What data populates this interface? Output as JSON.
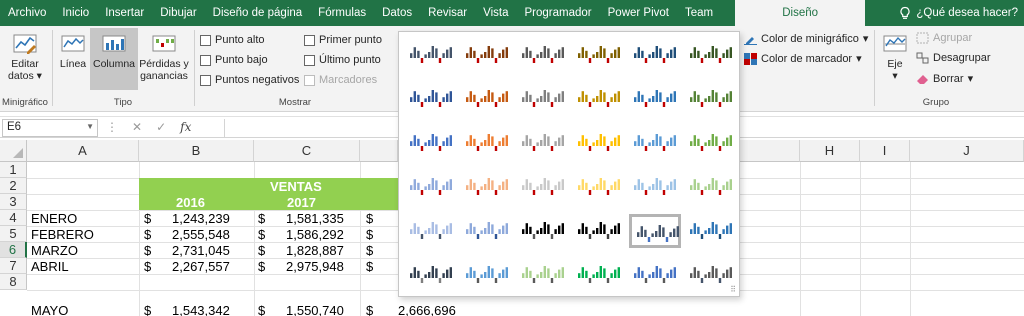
{
  "menu": {
    "tabs": [
      "Archivo",
      "Inicio",
      "Insertar",
      "Dibujar",
      "Diseño de página",
      "Fórmulas",
      "Datos",
      "Revisar",
      "Vista",
      "Programador",
      "Power Pivot",
      "Team"
    ],
    "active_tab": "Diseño",
    "help": "¿Qué desea hacer?"
  },
  "ribbon": {
    "sparkline_group": {
      "edit_line1": "Editar",
      "edit_line2": "datos",
      "label": "Minigráfico"
    },
    "type_group": {
      "line": "Línea",
      "column": "Columna",
      "winloss_line1": "Pérdidas y",
      "winloss_line2": "ganancias",
      "label": "Tipo"
    },
    "show_group": {
      "high_point": "Punto alto",
      "low_point": "Punto bajo",
      "negative_points": "Puntos negativos",
      "first_point": "Primer punto",
      "last_point": "Último punto",
      "markers": "Marcadores",
      "label": "Mostrar"
    },
    "style_group": {
      "sparkline_color": "Color de minigráfico",
      "marker_color": "Color de marcador"
    },
    "group_group": {
      "axis": "Eje",
      "group": "Agrupar",
      "ungroup": "Desagrupar",
      "clear": "Borrar",
      "label": "Grupo"
    }
  },
  "formula_bar": {
    "name_box": "E6",
    "formula": ""
  },
  "sheet": {
    "columns": [
      "A",
      "B",
      "C",
      "H",
      "I",
      "J"
    ],
    "rows": [
      "1",
      "2",
      "3",
      "4",
      "5",
      "6",
      "7",
      "8"
    ],
    "selected_row": "6",
    "title": "VENTAS",
    "years": [
      "2016",
      "2017"
    ],
    "currency": "$",
    "data": [
      {
        "month": "ENERO",
        "v2016": "1,243,239",
        "v2017": "1,581,335"
      },
      {
        "month": "FEBRERO",
        "v2016": "2,555,548",
        "v2017": "1,586,292"
      },
      {
        "month": "MARZO",
        "v2016": "2,731,045",
        "v2017": "1,828,887"
      },
      {
        "month": "ABRIL",
        "v2016": "2,267,557",
        "v2017": "2,975,948"
      },
      {
        "month": "MAYO",
        "v2016": "1,543,342",
        "v2017": "1,550,740",
        "v2018": "2,666,696"
      }
    ]
  },
  "gallery": {
    "selected": [
      4,
      4
    ],
    "swatches": [
      [
        [
          "#44546a",
          "#c00000"
        ],
        [
          "#843c0c",
          "#c00000"
        ],
        [
          "#595959",
          "#c00000"
        ],
        [
          "#7f6000",
          "#c00000"
        ],
        [
          "#1f4e79",
          "#c00000"
        ],
        [
          "#375623",
          "#c00000"
        ]
      ],
      [
        [
          "#2f5597",
          "#c00000"
        ],
        [
          "#c55a11",
          "#c00000"
        ],
        [
          "#7f7f7f",
          "#c00000"
        ],
        [
          "#bf9000",
          "#c00000"
        ],
        [
          "#2e75b6",
          "#c00000"
        ],
        [
          "#548235",
          "#c00000"
        ]
      ],
      [
        [
          "#4472c4",
          "#c00000"
        ],
        [
          "#ed7d31",
          "#c00000"
        ],
        [
          "#a5a5a5",
          "#c00000"
        ],
        [
          "#ffc000",
          "#c00000"
        ],
        [
          "#5b9bd5",
          "#c00000"
        ],
        [
          "#70ad47",
          "#c00000"
        ]
      ],
      [
        [
          "#8faadc",
          "#c00000"
        ],
        [
          "#f4b183",
          "#c00000"
        ],
        [
          "#c9c9c9",
          "#c00000"
        ],
        [
          "#ffd966",
          "#c00000"
        ],
        [
          "#9dc3e6",
          "#c00000"
        ],
        [
          "#a9d18e",
          "#c00000"
        ]
      ],
      [
        [
          "#a9bde4",
          "#44546a"
        ],
        [
          "#8ea9db",
          "#2f5597"
        ],
        [
          "#000000",
          "#595959"
        ],
        [
          "#000000",
          "#404040"
        ],
        [
          "#44546a",
          "#4472c4"
        ],
        [
          "#2e75b6",
          "#1f4e79"
        ]
      ],
      [
        [
          "#323f4f",
          "#7f7f7f"
        ],
        [
          "#5b9bd5",
          "#595959"
        ],
        [
          "#a9d18e",
          "#595959"
        ],
        [
          "#00b050",
          "#595959"
        ],
        [
          "#4472c4",
          "#595959"
        ],
        [
          "#595959",
          "#44546a"
        ]
      ]
    ],
    "pattern": [
      4,
      9,
      6,
      7,
      3,
      5,
      10,
      8,
      11,
      4,
      7,
      9
    ]
  }
}
